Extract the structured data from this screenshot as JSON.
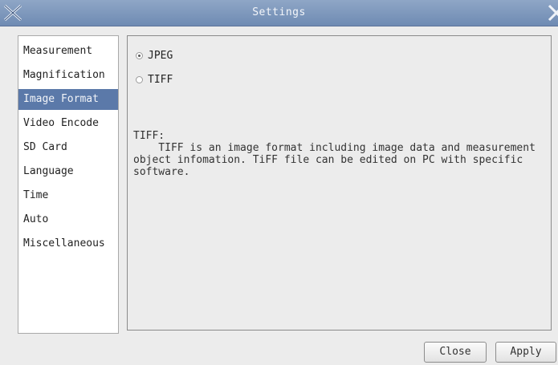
{
  "window": {
    "title": "Settings"
  },
  "sidebar": {
    "items": [
      {
        "label": "Measurement",
        "selected": false
      },
      {
        "label": "Magnification",
        "selected": false
      },
      {
        "label": "Image Format",
        "selected": true
      },
      {
        "label": "Video Encode",
        "selected": false
      },
      {
        "label": "SD Card",
        "selected": false
      },
      {
        "label": "Language",
        "selected": false
      },
      {
        "label": "Time",
        "selected": false
      },
      {
        "label": "Auto",
        "selected": false
      },
      {
        "label": "Miscellaneous",
        "selected": false
      }
    ]
  },
  "image_format": {
    "options": [
      {
        "label": "JPEG",
        "checked": true
      },
      {
        "label": "TIFF",
        "checked": false
      }
    ],
    "description_heading": "TIFF:",
    "description_body": "TIFF is an image format including image data and measurement object infomation. TiFF file can be edited on PC with specific software."
  },
  "buttons": {
    "close_label": "Close",
    "apply_label": "Apply"
  },
  "colors": {
    "titlebar": "#7b94b9",
    "selected_item": "#5b79a9",
    "background": "#ececec"
  },
  "icons": {
    "app": "x-logo-icon",
    "close": "close-icon"
  }
}
